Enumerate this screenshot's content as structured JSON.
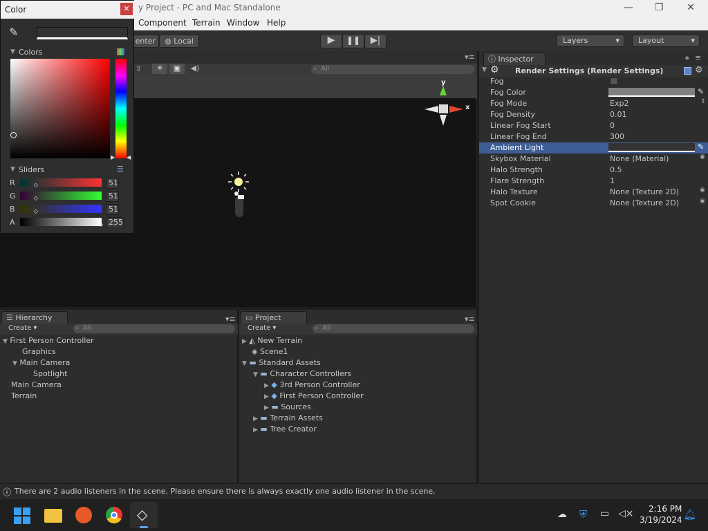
{
  "window": {
    "title": "y Project - PC and Mac Standalone",
    "minimize_glyph": "—",
    "maximize_glyph": "❐",
    "close_glyph": "✕"
  },
  "menu": [
    "Component",
    "Terrain",
    "Window",
    "Help"
  ],
  "toolbar": {
    "center_label": "enter",
    "local_label": "Local",
    "layers_label": "Layers",
    "layout_label": "Layout"
  },
  "scene": {
    "search_placeholder": "All",
    "gizmo_y": "y",
    "gizmo_x": "x"
  },
  "inspector": {
    "tab_label": "Inspector",
    "component_title": "Render Settings (Render Settings)",
    "properties": [
      {
        "label": "Fog",
        "value": ""
      },
      {
        "label": "Fog Color",
        "value": ""
      },
      {
        "label": "Fog Mode",
        "value": "Exp2"
      },
      {
        "label": "Fog Density",
        "value": "0.01"
      },
      {
        "label": "Linear Fog Start",
        "value": "0"
      },
      {
        "label": "Linear Fog End",
        "value": "300"
      },
      {
        "label": "Ambient Light",
        "value": ""
      },
      {
        "label": "Skybox Material",
        "value": "None (Material)"
      },
      {
        "label": "Halo Strength",
        "value": "0.5"
      },
      {
        "label": "Flare Strength",
        "value": "1"
      },
      {
        "label": "Halo Texture",
        "value": "None (Texture 2D)"
      },
      {
        "label": "Spot Cookie",
        "value": "None (Texture 2D)"
      }
    ]
  },
  "hierarchy": {
    "tab_label": "Hierarchy",
    "create_label": "Create",
    "search_placeholder": "All",
    "items": [
      {
        "label": "First Person Controller"
      },
      {
        "label": "Graphics"
      },
      {
        "label": "Main Camera"
      },
      {
        "label": "Spotlight"
      },
      {
        "label": "Main Camera"
      },
      {
        "label": "Terrain"
      }
    ]
  },
  "project": {
    "tab_label": "Project",
    "create_label": "Create",
    "search_placeholder": "All",
    "items": [
      {
        "label": "New Terrain"
      },
      {
        "label": "Scene1"
      },
      {
        "label": "Standard Assets"
      },
      {
        "label": "Character Controllers"
      },
      {
        "label": "3rd Person Controller"
      },
      {
        "label": "First Person Controller"
      },
      {
        "label": "Sources"
      },
      {
        "label": "Terrain Assets"
      },
      {
        "label": "Tree Creator"
      }
    ]
  },
  "color_window": {
    "title": "Color",
    "colors_label": "Colors",
    "sliders_label": "Sliders",
    "channels": [
      {
        "label": "R",
        "value": "51"
      },
      {
        "label": "G",
        "value": "51"
      },
      {
        "label": "B",
        "value": "51"
      },
      {
        "label": "A",
        "value": "255"
      }
    ]
  },
  "status": {
    "message": "There are 2 audio listeners in the scene. Please ensure there is always exactly one audio listener in the scene."
  },
  "taskbar": {
    "time": "2:16 PM",
    "date": "3/19/2024"
  },
  "colors": {
    "selection": "#3e5f96",
    "editor_bg": "#2d2d2d"
  }
}
